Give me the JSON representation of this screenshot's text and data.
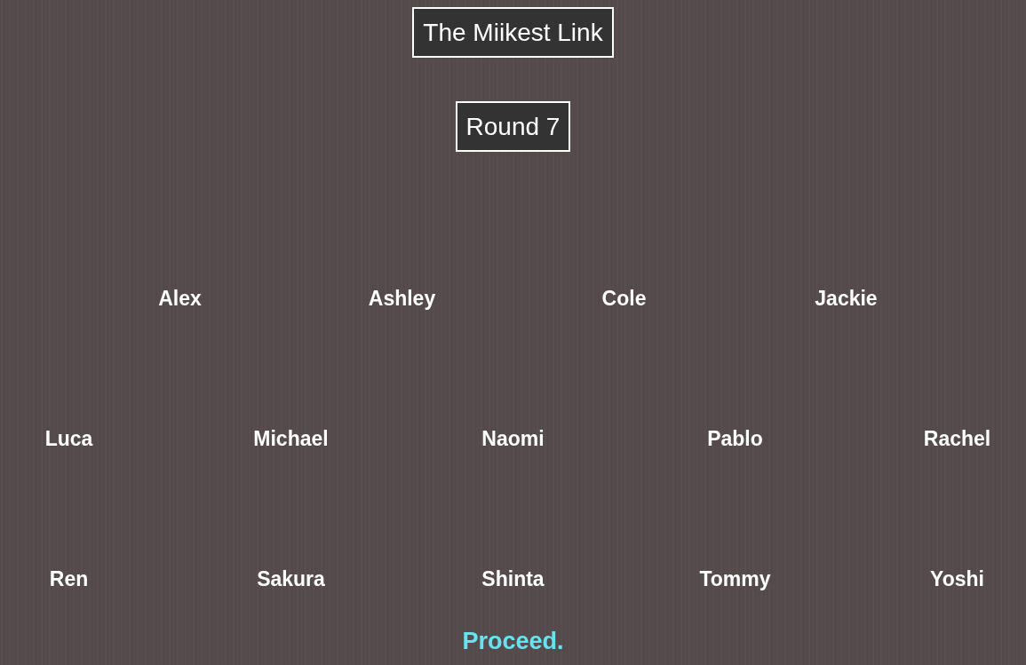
{
  "title": "The Miikest Link",
  "round": "Round 7",
  "contestant_rows": [
    [
      "Alex",
      "Ashley",
      "Cole",
      "Jackie"
    ],
    [
      "Luca",
      "Michael",
      "Naomi",
      "Pablo",
      "Rachel"
    ],
    [
      "Ren",
      "Sakura",
      "Shinta",
      "Tommy",
      "Yoshi"
    ]
  ],
  "proceed_link": "Proceed."
}
